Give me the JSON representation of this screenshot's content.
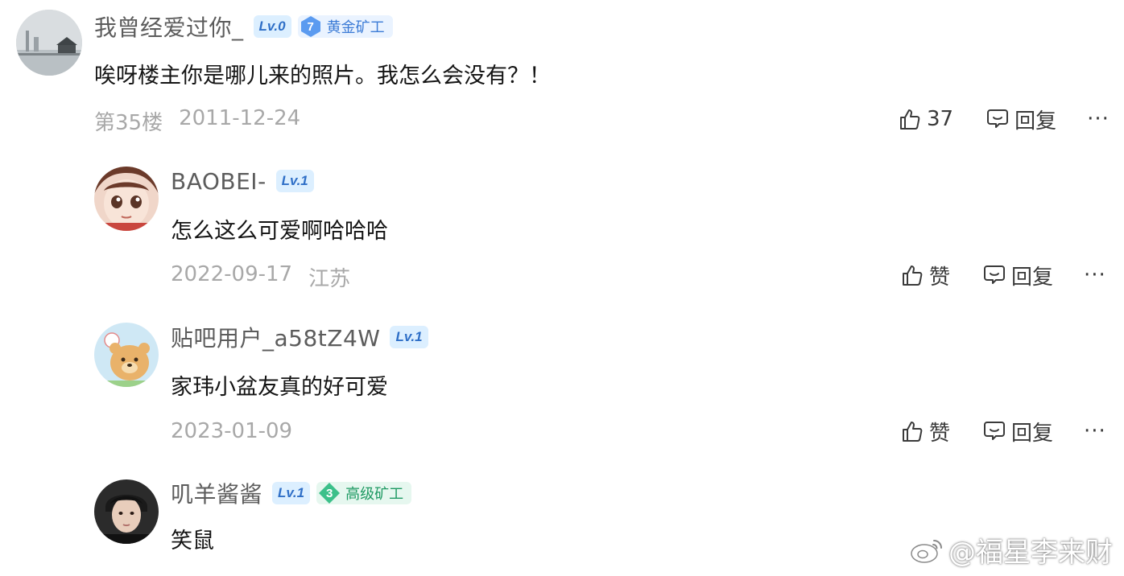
{
  "comments": [
    {
      "username": "我曾经爱过你_",
      "level": "Lv.0",
      "rank": {
        "num": "7",
        "title": "黄金矿工",
        "color": "#5b9bf0"
      },
      "text": "唉呀楼主你是哪儿来的照片。我怎么会没有？！",
      "floor": "第35楼",
      "date": "2011-12-24",
      "likes": "37",
      "reply": "回复",
      "more": "···"
    },
    {
      "username": "BAOBEI-",
      "level": "Lv.1",
      "text": "怎么这么可爱啊哈哈哈",
      "date": "2022-09-17",
      "location": "江苏",
      "like_label": "赞",
      "reply": "回复",
      "more": "···"
    },
    {
      "username": "贴吧用户_a58tZ4W",
      "level": "Lv.1",
      "text": "家玮小盆友真的好可爱",
      "date": "2023-01-09",
      "like_label": "赞",
      "reply": "回复",
      "more": "···"
    },
    {
      "username": "叽羊酱酱",
      "level": "Lv.1",
      "rank": {
        "num": "3",
        "title": "高级矿工",
        "color": "#3cc08a"
      },
      "text": "笑鼠"
    }
  ],
  "watermark": "@福星李来财",
  "icons": {
    "like": "thumbs-up-icon",
    "reply": "speech-bubble-icon",
    "more": "more-dots-icon",
    "weibo": "weibo-logo-icon"
  }
}
